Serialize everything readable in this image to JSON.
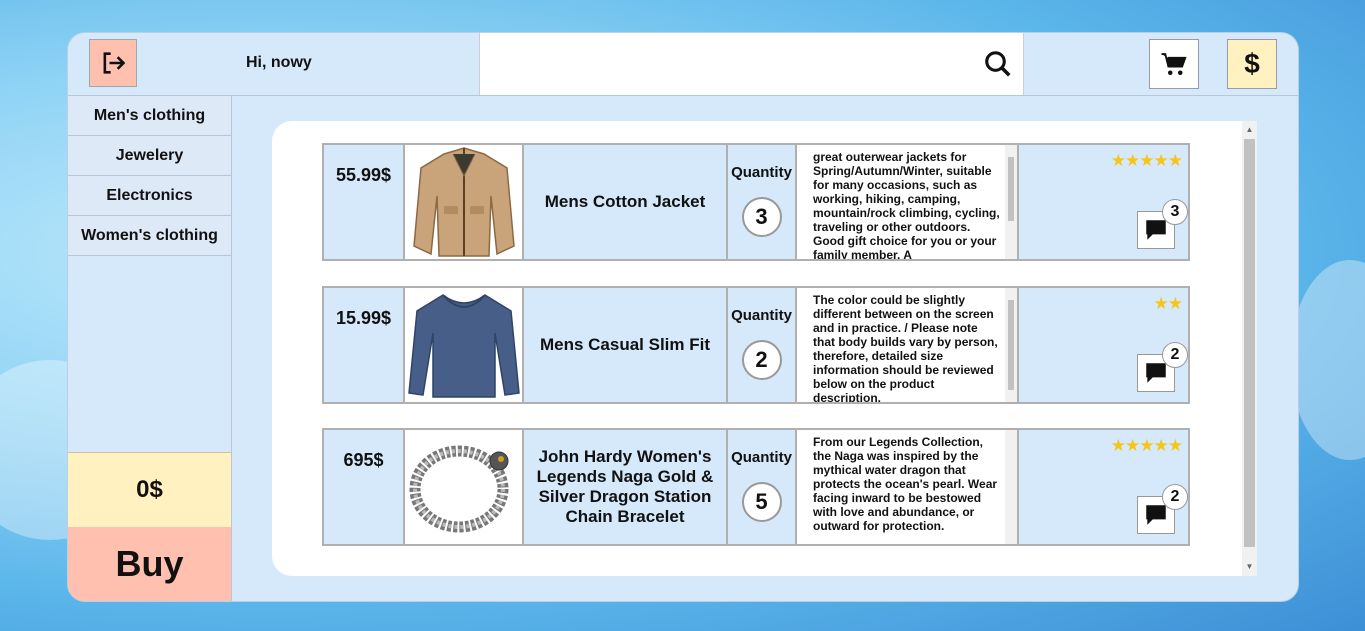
{
  "header": {
    "greeting": "Hi, nowy",
    "search": {
      "placeholder": "",
      "value": ""
    }
  },
  "sidebar": {
    "categories": [
      "Men's clothing",
      "Jewelery",
      "Electronics",
      "Women's clothing"
    ],
    "total": "0$",
    "buy_label": "Buy"
  },
  "products": [
    {
      "price": "55.99$",
      "name": "Mens Cotton Jacket",
      "quantity_label": "Quantity",
      "quantity": "3",
      "description": "great outerwear jackets for Spring/Autumn/Winter, suitable for many occasions, such as working, hiking, camping, mountain/rock climbing, cycling, traveling or other outdoors. Good gift choice for you or your family member. A",
      "stars": 5,
      "comments": "3",
      "image_icon": "jacket-image"
    },
    {
      "price": "15.99$",
      "name": "Mens Casual Slim Fit",
      "quantity_label": "Quantity",
      "quantity": "2",
      "description": "The color could be slightly different between on the screen and in practice. / Please note that body builds vary by person, therefore, detailed size information should be reviewed below on the product description.",
      "stars": 2,
      "comments": "2",
      "image_icon": "shirt-image"
    },
    {
      "price": "695$",
      "name": "John Hardy Women's Legends Naga Gold & Silver Dragon Station Chain Bracelet",
      "quantity_label": "Quantity",
      "quantity": "5",
      "description": "From our Legends Collection, the Naga was inspired by the mythical water dragon that protects the ocean's pearl. Wear facing inward to be bestowed with love and abundance, or outward for protection.",
      "stars": 5,
      "comments": "2",
      "image_icon": "bracelet-image"
    }
  ],
  "colors": {
    "logout_bg": "#ffc0b0",
    "money_bg": "#fff2c0",
    "panel_bg": "#d5e9fb",
    "star": "#f5c518"
  }
}
